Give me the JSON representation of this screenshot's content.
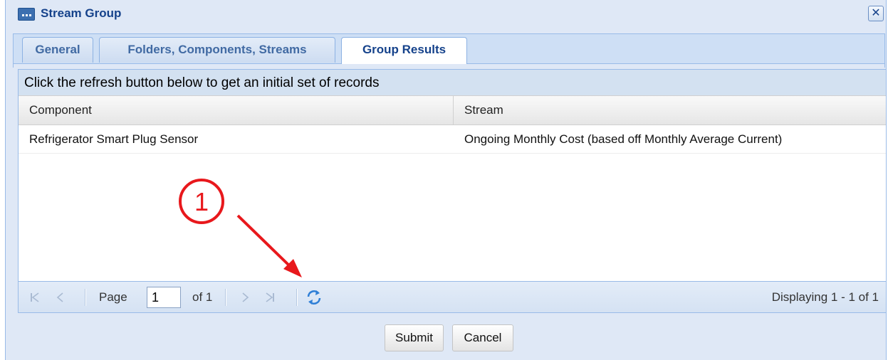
{
  "window": {
    "title": "Stream Group",
    "close_label": "✕"
  },
  "tabs": [
    {
      "label": "General"
    },
    {
      "label": "Folders, Components, Streams"
    },
    {
      "label": "Group Results",
      "active": true
    }
  ],
  "panel": {
    "header": "Click the refresh button below to get an initial set of records",
    "columns": [
      "Component",
      "Stream"
    ],
    "rows": [
      {
        "component": "Refrigerator Smart Plug Sensor",
        "stream": "Ongoing Monthly Cost (based off Monthly Average Current)"
      }
    ]
  },
  "pager": {
    "page_label": "Page",
    "page_value": "1",
    "of_label": "of 1",
    "info": "Displaying 1 - 1 of 1",
    "icons": [
      "first-page-icon",
      "prev-page-icon",
      "next-page-icon",
      "last-page-icon",
      "refresh-icon"
    ]
  },
  "buttons": {
    "submit": "Submit",
    "cancel": "Cancel"
  },
  "annotation": {
    "marker": "1",
    "color": "#e8181c"
  },
  "colors": {
    "title": "#15428b",
    "panel_bg": "#dfe8f6",
    "border": "#99bbe8",
    "refresh_icon": "#2f7fd6"
  }
}
